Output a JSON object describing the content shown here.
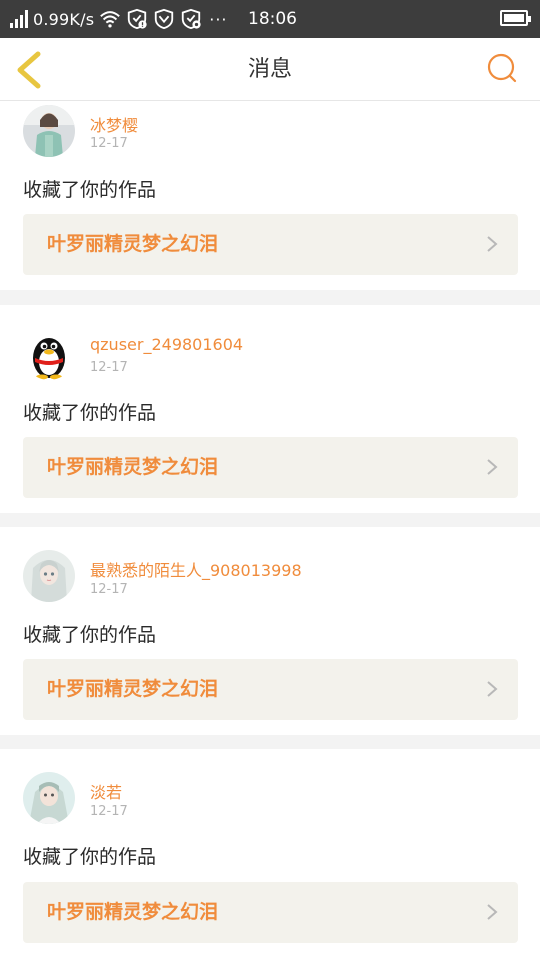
{
  "status_bar": {
    "net_speed": "0.99K/s",
    "time": "18:06",
    "more": "···"
  },
  "header": {
    "title": "消息"
  },
  "colors": {
    "accent": "#f08c3c",
    "back_arrow": "#e8c640",
    "card_bg": "#f3f2ec"
  },
  "messages": [
    {
      "username": "冰梦樱",
      "date": "12-17",
      "text": "收藏了你的作品",
      "work_title": "叶罗丽精灵梦之幻泪"
    },
    {
      "username": "qzuser_249801604",
      "date": "12-17",
      "text": "收藏了你的作品",
      "work_title": "叶罗丽精灵梦之幻泪"
    },
    {
      "username": "最熟悉的陌生人_908013998",
      "date": "12-17",
      "text": "收藏了你的作品",
      "work_title": "叶罗丽精灵梦之幻泪"
    },
    {
      "username": "淡若",
      "date": "12-17",
      "text": "收藏了你的作品",
      "work_title": "叶罗丽精灵梦之幻泪"
    }
  ]
}
